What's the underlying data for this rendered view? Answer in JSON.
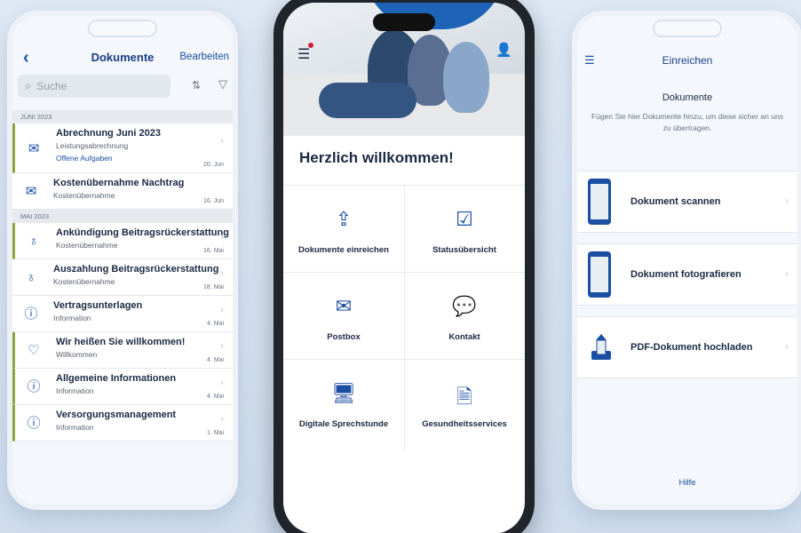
{
  "left_phone": {
    "header": {
      "back_icon": "chevron-left-icon",
      "title": "Dokumente",
      "edit": "Bearbeiten"
    },
    "search": {
      "placeholder": "Suche",
      "sort_icon": "sort-icon",
      "filter_icon": "filter-icon"
    },
    "sections": [
      {
        "label": "JUNI 2023"
      },
      {
        "label": "MAI 2023"
      }
    ],
    "items": [
      {
        "title": "Abrechnung Juni 2023",
        "subtitle": "Leistungsabrechnung",
        "extra": "Offene Aufgaben",
        "date": "20. Jun",
        "icon": "envelope-icon"
      },
      {
        "title": "Kostenübernahme Nachtrag",
        "subtitle": "Kostenübernahme",
        "date": "16. Jun",
        "icon": "envelope-icon"
      },
      {
        "title": "Ankündigung Beitragsrückerstattung",
        "subtitle": "Kostenübernahme",
        "date": "16. Mai",
        "icon": "money-bag-icon"
      },
      {
        "title": "Auszahlung Beitragsrückerstattung",
        "subtitle": "Kostenübernahme",
        "date": "18. Mai",
        "icon": "money-bag-icon"
      },
      {
        "title": "Vertragsunterlagen",
        "subtitle": "Information",
        "date": "4. Mai",
        "icon": "info-icon"
      },
      {
        "title": "Wir heißen Sie willkommen!",
        "subtitle": "Willkommen",
        "date": "4. Mai",
        "icon": "heart-hands-icon"
      },
      {
        "title": "Allgemeine Informationen",
        "subtitle": "Information",
        "date": "4. Mai",
        "icon": "info-icon"
      },
      {
        "title": "Versorgungsmanagement",
        "subtitle": "Information",
        "date": "1. Mai",
        "icon": "info-icon"
      }
    ]
  },
  "center_phone": {
    "welcome": "Herzlich willkommen!",
    "tiles": [
      {
        "label": "Dokumente einreichen",
        "icon": "upload-icon"
      },
      {
        "label": "Statusübersicht",
        "icon": "checklist-icon"
      },
      {
        "label": "Postbox",
        "icon": "envelope-icon"
      },
      {
        "label": "Kontakt",
        "icon": "chat-icon"
      },
      {
        "label": "Digitale Sprechstunde",
        "icon": "monitor-stethoscope-icon"
      },
      {
        "label": "Gesundheitsservices",
        "icon": "document-heart-icon"
      }
    ]
  },
  "right_phone": {
    "header": {
      "menu_icon": "hamburger-icon",
      "title": "Einreichen"
    },
    "heading": "Dokumente",
    "description": "Fügen Sie hier Dokumente hinzu, um diese sicher an uns zu übertragen.",
    "options": [
      {
        "label": "Dokument scannen",
        "icon": "phone-scan-icon"
      },
      {
        "label": "Dokument fotografieren",
        "icon": "phone-camera-icon"
      },
      {
        "label": "PDF-Dokument hochladen",
        "icon": "upload-tray-icon"
      }
    ],
    "help": "Hilfe"
  }
}
